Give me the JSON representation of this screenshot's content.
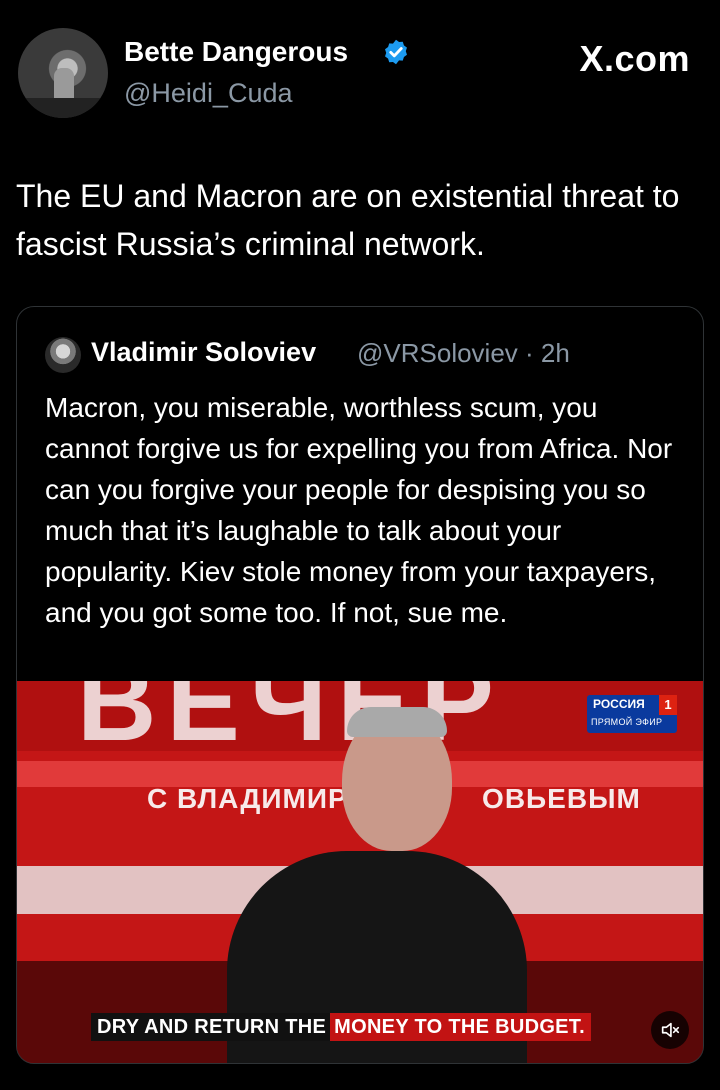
{
  "author": {
    "display_name": "Bette Dangerous",
    "handle": "@Heidi_Cuda",
    "verified": true
  },
  "brand": {
    "site": "X.com"
  },
  "tweet": {
    "text": "The EU and Macron are on existential threat to fascist Russia’s criminal network."
  },
  "quoted_tweet": {
    "display_name": "Vladimir Soloviev",
    "handle_time": "@VRSoloviev · 2h",
    "text": "Macron, you miserable, worthless scum, you cannot forgive us for expelling you from Africa. Nor can you forgive your people for despising you so much that it’s laughable to talk about your popularity. Kiev stole money from your taxpayers, and you got some too. If not, sue me."
  },
  "video": {
    "background_letters": "ВЕЧЕР",
    "program_line": "С ВЛАДИМИРО",
    "program_line_end": "ОВЬЕВЫМ",
    "channel_name": "РОССИЯ",
    "channel_number": "1",
    "channel_sub": "ПРЯМОЙ ЭФИР",
    "caption_dark": "DRY AND RETURN THE",
    "caption_red": "MONEY TO THE BUDGET.",
    "muted": true
  },
  "colors": {
    "background": "#000000",
    "text": "#ffffff",
    "secondary": "#8b98a5",
    "verified": "#1d9bf0",
    "border": "#2f3336"
  }
}
